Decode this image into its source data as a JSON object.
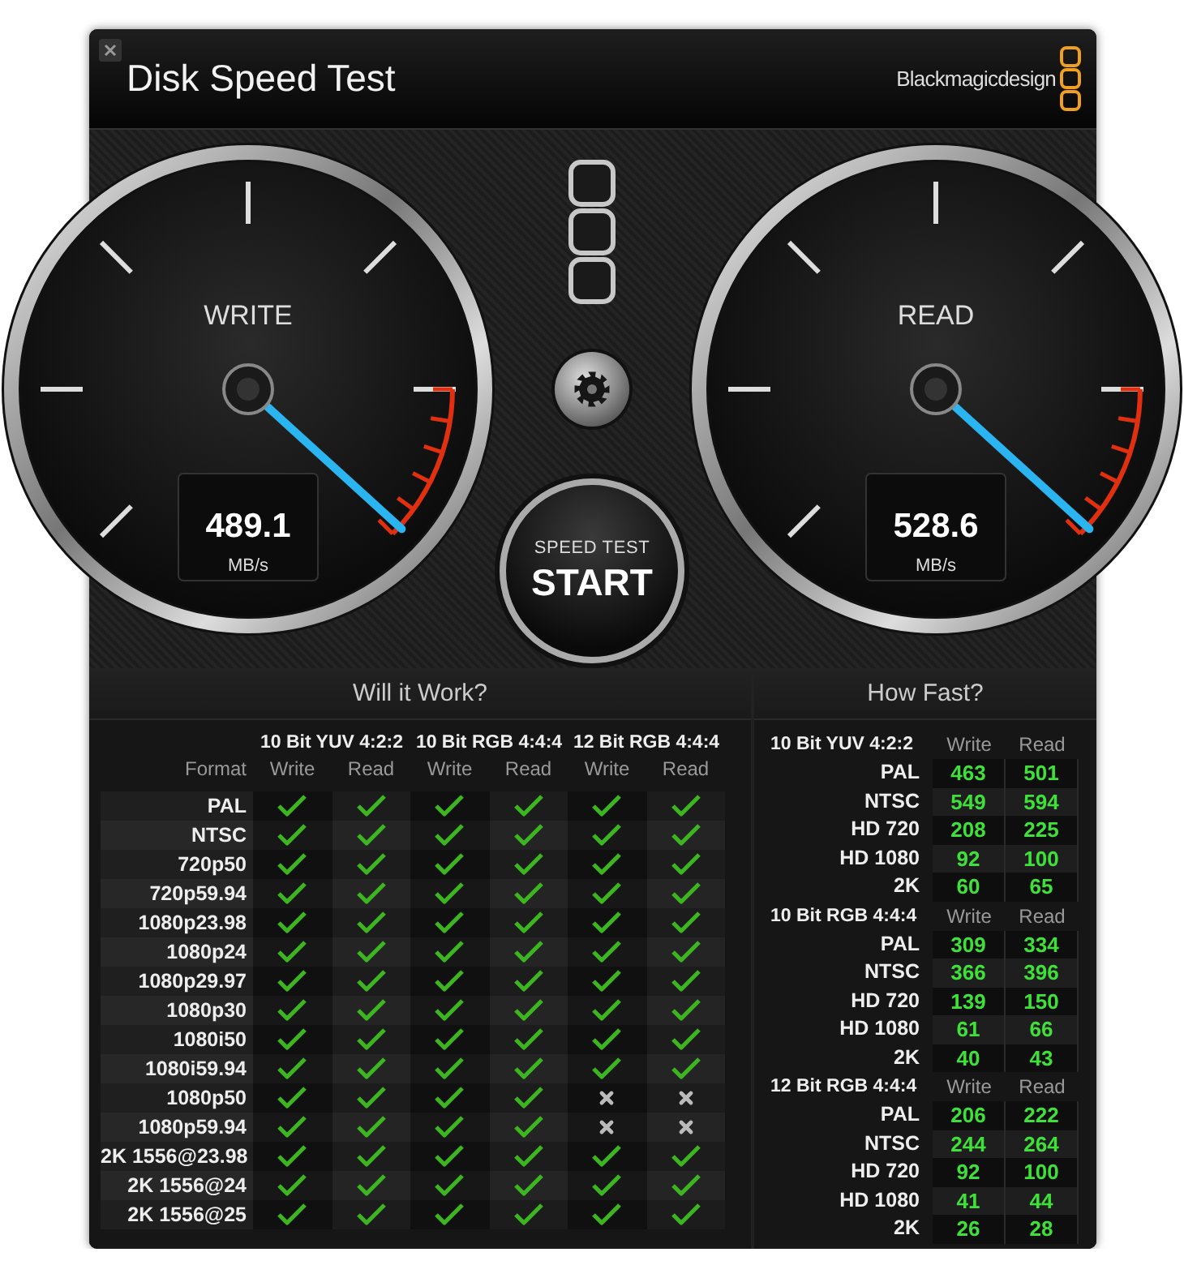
{
  "window": {
    "title": "Disk Speed Test",
    "brand": "Blackmagicdesign"
  },
  "gauges": [
    {
      "label": "WRITE",
      "value": "489.1",
      "unit": "MB/s",
      "level": 0.99
    },
    {
      "label": "READ",
      "value": "528.6",
      "unit": "MB/s",
      "level": 0.99
    }
  ],
  "start_button": {
    "caption": "SPEED TEST",
    "label": "START"
  },
  "will_it_work": {
    "title": "Will it Work?",
    "format_header": "Format",
    "groups": [
      {
        "name": "10 Bit YUV 4:2:2",
        "columns": [
          "Write",
          "Read"
        ]
      },
      {
        "name": "10 Bit RGB 4:4:4",
        "columns": [
          "Write",
          "Read"
        ]
      },
      {
        "name": "12 Bit RGB 4:4:4",
        "columns": [
          "Write",
          "Read"
        ]
      }
    ],
    "rows": [
      {
        "format": "PAL",
        "results": [
          true,
          true,
          true,
          true,
          true,
          true
        ]
      },
      {
        "format": "NTSC",
        "results": [
          true,
          true,
          true,
          true,
          true,
          true
        ]
      },
      {
        "format": "720p50",
        "results": [
          true,
          true,
          true,
          true,
          true,
          true
        ]
      },
      {
        "format": "720p59.94",
        "results": [
          true,
          true,
          true,
          true,
          true,
          true
        ]
      },
      {
        "format": "1080p23.98",
        "results": [
          true,
          true,
          true,
          true,
          true,
          true
        ]
      },
      {
        "format": "1080p24",
        "results": [
          true,
          true,
          true,
          true,
          true,
          true
        ]
      },
      {
        "format": "1080p29.97",
        "results": [
          true,
          true,
          true,
          true,
          true,
          true
        ]
      },
      {
        "format": "1080p30",
        "results": [
          true,
          true,
          true,
          true,
          true,
          true
        ]
      },
      {
        "format": "1080i50",
        "results": [
          true,
          true,
          true,
          true,
          true,
          true
        ]
      },
      {
        "format": "1080i59.94",
        "results": [
          true,
          true,
          true,
          true,
          true,
          true
        ]
      },
      {
        "format": "1080p50",
        "results": [
          true,
          true,
          true,
          true,
          false,
          false
        ]
      },
      {
        "format": "1080p59.94",
        "results": [
          true,
          true,
          true,
          true,
          false,
          false
        ]
      },
      {
        "format": "2K 1556@23.98",
        "results": [
          true,
          true,
          true,
          true,
          true,
          true
        ]
      },
      {
        "format": "2K 1556@24",
        "results": [
          true,
          true,
          true,
          true,
          true,
          true
        ]
      },
      {
        "format": "2K 1556@25",
        "results": [
          true,
          true,
          true,
          true,
          true,
          true
        ]
      }
    ]
  },
  "how_fast": {
    "title": "How Fast?",
    "groups": [
      {
        "name": "10 Bit YUV 4:2:2",
        "columns": [
          "Write",
          "Read"
        ],
        "rows": [
          {
            "format": "PAL",
            "write": "463",
            "read": "501"
          },
          {
            "format": "NTSC",
            "write": "549",
            "read": "594"
          },
          {
            "format": "HD 720",
            "write": "208",
            "read": "225"
          },
          {
            "format": "HD 1080",
            "write": "92",
            "read": "100"
          },
          {
            "format": "2K",
            "write": "60",
            "read": "65"
          }
        ]
      },
      {
        "name": "10 Bit RGB 4:4:4",
        "columns": [
          "Write",
          "Read"
        ],
        "rows": [
          {
            "format": "PAL",
            "write": "309",
            "read": "334"
          },
          {
            "format": "NTSC",
            "write": "366",
            "read": "396"
          },
          {
            "format": "HD 720",
            "write": "139",
            "read": "150"
          },
          {
            "format": "HD 1080",
            "write": "61",
            "read": "66"
          },
          {
            "format": "2K",
            "write": "40",
            "read": "43"
          }
        ]
      },
      {
        "name": "12 Bit RGB 4:4:4",
        "columns": [
          "Write",
          "Read"
        ],
        "rows": [
          {
            "format": "PAL",
            "write": "206",
            "read": "222"
          },
          {
            "format": "NTSC",
            "write": "244",
            "read": "264"
          },
          {
            "format": "HD 720",
            "write": "92",
            "read": "100"
          },
          {
            "format": "HD 1080",
            "write": "41",
            "read": "44"
          },
          {
            "format": "2K",
            "write": "26",
            "read": "28"
          }
        ]
      }
    ]
  }
}
